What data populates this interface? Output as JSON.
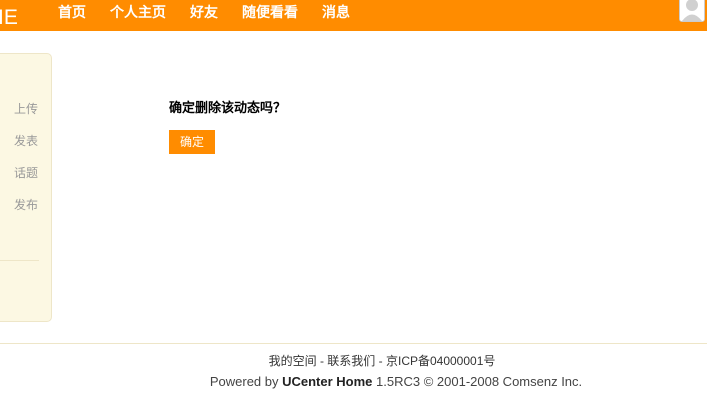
{
  "header": {
    "logo_text": "IE",
    "nav": [
      "首页",
      "个人主页",
      "好友",
      "随便看看",
      "消息"
    ]
  },
  "sidebar": {
    "items": [
      "上传",
      "发表",
      "话题",
      "发布"
    ]
  },
  "main": {
    "question": "确定删除该动态吗？",
    "confirm_label": "确定"
  },
  "footer": {
    "link_space": "我的空间",
    "link_contact": "联系我们",
    "icp": "京ICP备04000001号",
    "separator": " - ",
    "powered_prefix": "Powered by ",
    "product": "UCenter Home",
    "version": " 1.5RC3 © 2001-2008 Comsenz Inc."
  },
  "colors": {
    "brand": "#FF8C00",
    "sidebar_bg": "#FCF8E3"
  },
  "icons": {
    "avatar": "user-avatar-icon"
  }
}
